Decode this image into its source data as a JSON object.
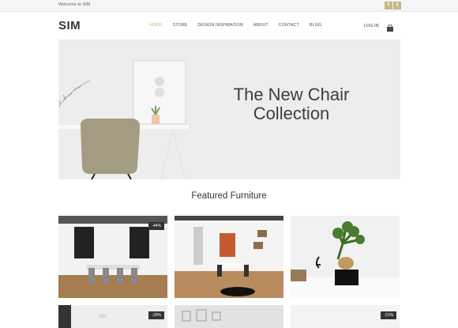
{
  "topbar": {
    "welcome": "Welcome to SIM",
    "social": [
      "f",
      "t"
    ]
  },
  "header": {
    "logo": "SIM",
    "nav": [
      "HOME",
      "STORE",
      "DESIGN INSPIRATION",
      "ABOUT",
      "CONTACT",
      "BLOG"
    ],
    "active": "HOME",
    "login": "LOG IN",
    "cart_icon": "shopping-bag-icon"
  },
  "hero": {
    "title": "The New Chair Collection"
  },
  "featured": {
    "title": "Featured Furniture",
    "products": [
      {
        "badge": "-44%"
      },
      {
        "badge": ""
      },
      {
        "badge": ""
      },
      {
        "badge": "-20%"
      },
      {
        "badge": ""
      },
      {
        "badge": "-21%"
      }
    ]
  },
  "colors": {
    "accent": "#c8b68a",
    "badge": "#333333",
    "hero_bg": "#ebebeb"
  }
}
